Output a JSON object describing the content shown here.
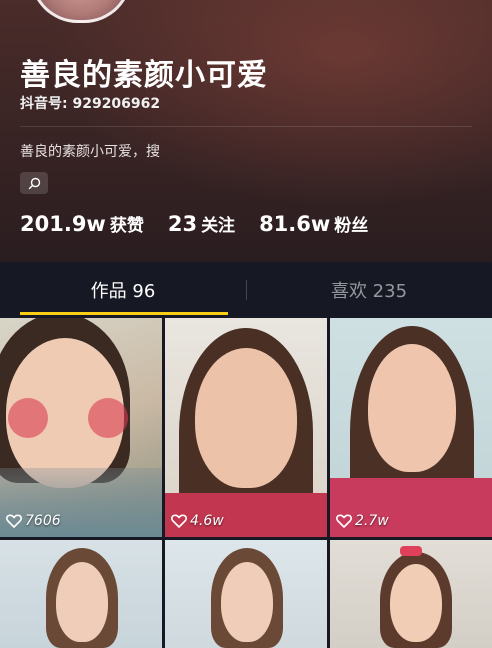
{
  "profile": {
    "name": "善良的素颜小可爱",
    "douyin_id": "抖音号: 929206962",
    "bio": "善良的素颜小可爱，搜",
    "stats": [
      {
        "num": "201.9w",
        "label": "获赞"
      },
      {
        "num": "23",
        "label": "关注"
      },
      {
        "num": "81.6w",
        "label": "粉丝"
      }
    ]
  },
  "tabs": [
    {
      "label": "作品 96",
      "active": true
    },
    {
      "label": "喜欢 235",
      "active": false
    }
  ],
  "videos": [
    {
      "likes": "7606"
    },
    {
      "likes": "4.6w"
    },
    {
      "likes": "2.7w"
    },
    {
      "likes": ""
    },
    {
      "likes": ""
    },
    {
      "likes": ""
    }
  ],
  "icons": {
    "search": "search-icon",
    "heart": "heart-outline-icon"
  },
  "colors": {
    "accent": "#face15",
    "background": "#161823"
  }
}
